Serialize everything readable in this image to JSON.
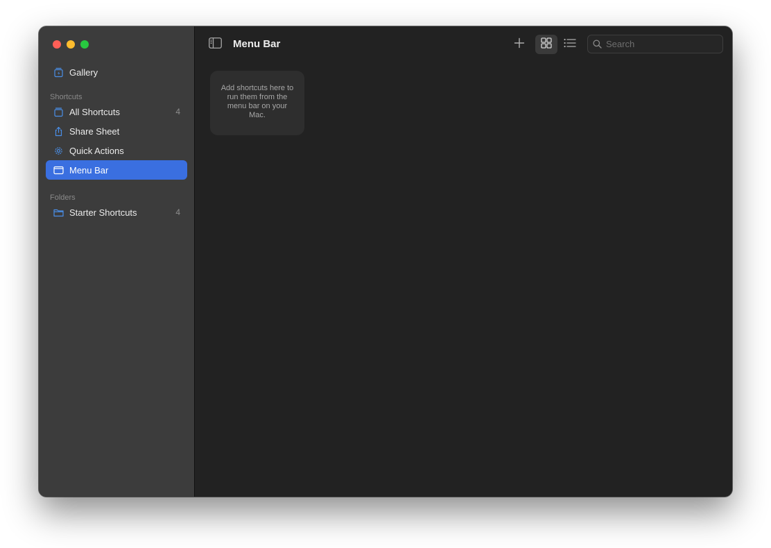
{
  "window": {
    "traffic_lights": {
      "close_color": "#ff5f57",
      "minimize_color": "#febc2e",
      "zoom_color": "#28c840"
    }
  },
  "sidebar": {
    "gallery_label": "Gallery",
    "shortcuts_header": "Shortcuts",
    "shortcuts_items": [
      {
        "label": "All Shortcuts",
        "count": "4",
        "icon": "stack-icon"
      },
      {
        "label": "Share Sheet",
        "count": "",
        "icon": "share-icon"
      },
      {
        "label": "Quick Actions",
        "count": "",
        "icon": "gear-icon"
      },
      {
        "label": "Menu Bar",
        "count": "",
        "icon": "menubar-icon",
        "selected": true
      }
    ],
    "folders_header": "Folders",
    "folder_items": [
      {
        "label": "Starter Shortcuts",
        "count": "4",
        "icon": "folder-icon"
      }
    ]
  },
  "toolbar": {
    "title": "Menu Bar",
    "add_icon": "plus-icon",
    "grid_view_icon": "grid-icon",
    "list_view_icon": "list-icon",
    "search_placeholder": "Search"
  },
  "main": {
    "empty_message": "Add shortcuts here to run them from the menu bar on your Mac."
  },
  "colors": {
    "accent": "#3a6fe0",
    "icon_blue": "#4a8fe8"
  }
}
